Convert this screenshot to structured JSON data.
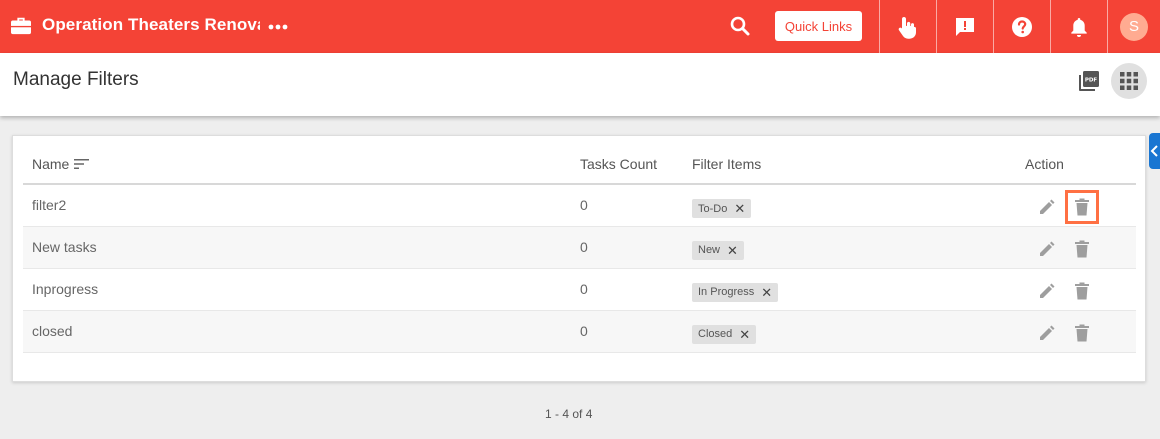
{
  "header": {
    "title": "Operation Theaters Renovation",
    "quick_links": "Quick Links",
    "avatar_initial": "S",
    "accent": "#f44336"
  },
  "page": {
    "title": "Manage Filters"
  },
  "table": {
    "columns": {
      "name": "Name",
      "tasks_count": "Tasks Count",
      "filter_items": "Filter Items",
      "action": "Action"
    },
    "rows": [
      {
        "name": "filter2",
        "count": "0",
        "chip": "To-Do"
      },
      {
        "name": "New tasks",
        "count": "0",
        "chip": "New"
      },
      {
        "name": "Inprogress",
        "count": "0",
        "chip": "In Progress"
      },
      {
        "name": "closed",
        "count": "0",
        "chip": "Closed"
      }
    ]
  },
  "pagination": {
    "range": "1 - 4 of 4"
  },
  "icons": [
    "briefcase-icon",
    "more-horiz-icon",
    "search-icon",
    "touch-icon",
    "feedback-icon",
    "help-icon",
    "bell-icon",
    "pdf-icon",
    "apps-grid-icon",
    "sort-icon",
    "close-icon",
    "edit-icon",
    "delete-icon"
  ]
}
